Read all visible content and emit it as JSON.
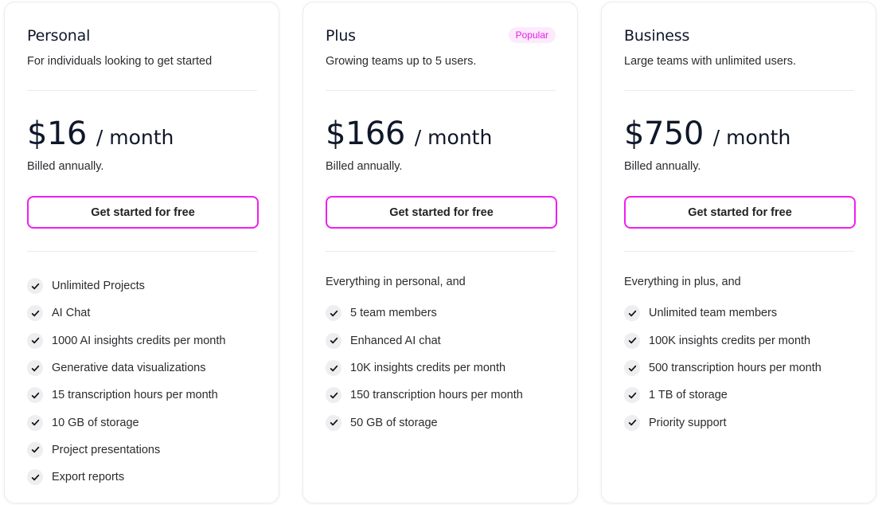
{
  "colors": {
    "accent": "#f01ef0",
    "badge_bg": "#fdeafd",
    "badge_text": "#e61ee6",
    "heading": "#0f172a"
  },
  "plans": [
    {
      "name": "Personal",
      "description": "For individuals looking to get started",
      "badge": null,
      "price": "$16",
      "period": "/ month",
      "billing": "Billed annually.",
      "cta_label": "Get started for free",
      "intro": null,
      "features": [
        "Unlimited Projects",
        "AI Chat",
        "1000 AI insights credits per month",
        "Generative data visualizations",
        "15 transcription hours per month",
        "10 GB of storage",
        "Project presentations",
        "Export reports"
      ],
      "feature_icon": "check-icon"
    },
    {
      "name": "Plus",
      "description": "Growing teams up to 5 users.",
      "badge": "Popular",
      "price": "$166",
      "period": "/ month",
      "billing": "Billed annually.",
      "cta_label": "Get started for free",
      "intro": "Everything in personal, and",
      "features": [
        "5 team members",
        "Enhanced AI chat",
        "10K insights credits per month",
        "150 transcription hours per month",
        "50 GB of storage"
      ],
      "feature_icon": "check-icon"
    },
    {
      "name": "Business",
      "description": "Large teams with unlimited users.",
      "badge": null,
      "price": "$750",
      "period": "/ month",
      "billing": "Billed annually.",
      "cta_label": "Get started for free",
      "intro": "Everything in plus, and",
      "features": [
        "Unlimited team members",
        "100K insights credits per month",
        "500 transcription hours per month",
        "1 TB of storage",
        "Priority support"
      ],
      "feature_icon": "check-icon"
    }
  ]
}
